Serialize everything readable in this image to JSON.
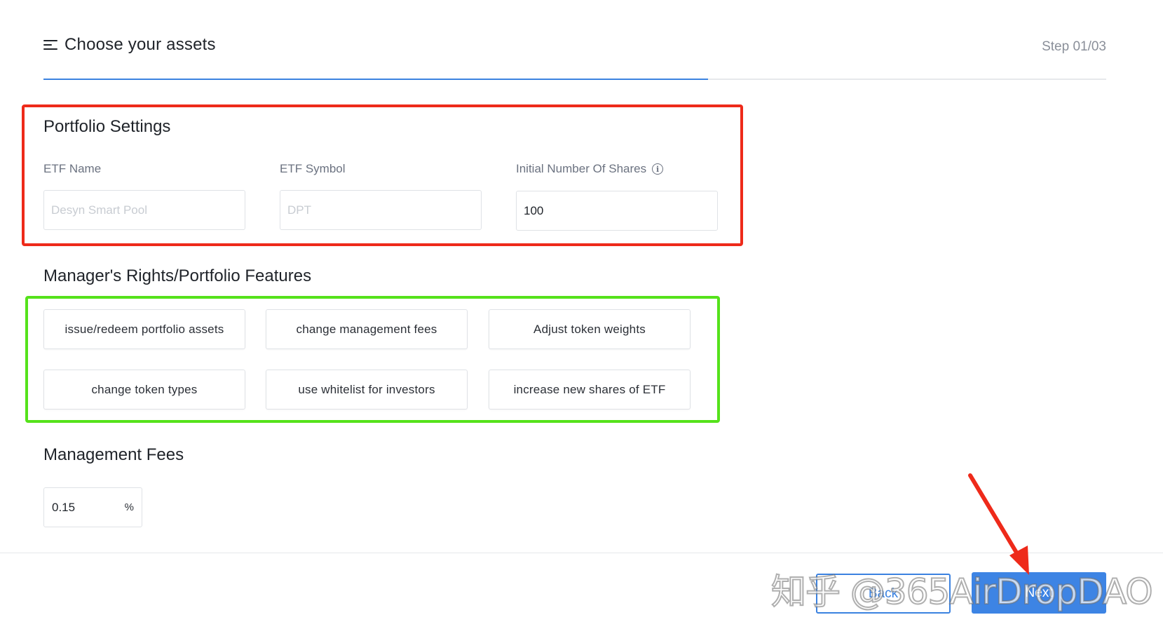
{
  "header": {
    "title": "Choose your assets",
    "step": "Step 01/03",
    "progress": 0.625
  },
  "portfolio_settings": {
    "title": "Portfolio Settings",
    "etf_name": {
      "label": "ETF Name",
      "placeholder": "Desyn Smart Pool"
    },
    "etf_symbol": {
      "label": "ETF Symbol",
      "placeholder": "DPT"
    },
    "initial_shares": {
      "label": "Initial Number Of Shares",
      "value": "100"
    }
  },
  "features": {
    "title": "Manager's Rights/Portfolio Features",
    "items": [
      "issue/redeem portfolio assets",
      "change management fees",
      "Adjust token weights",
      "change token types",
      "use whitelist for investors",
      "increase new shares of ETF"
    ]
  },
  "management_fees": {
    "title": "Management Fees",
    "value": "0.15",
    "unit": "%"
  },
  "footer": {
    "back_label": "Back",
    "next_label": "Next"
  },
  "annotations": {
    "settings_box_color": "#ee2a1a",
    "features_box_color": "#55e21b",
    "arrow_color": "#ee2a1a"
  },
  "watermark": "知乎 @365AirDropDAO",
  "colors": {
    "accent": "#3b82e0"
  }
}
